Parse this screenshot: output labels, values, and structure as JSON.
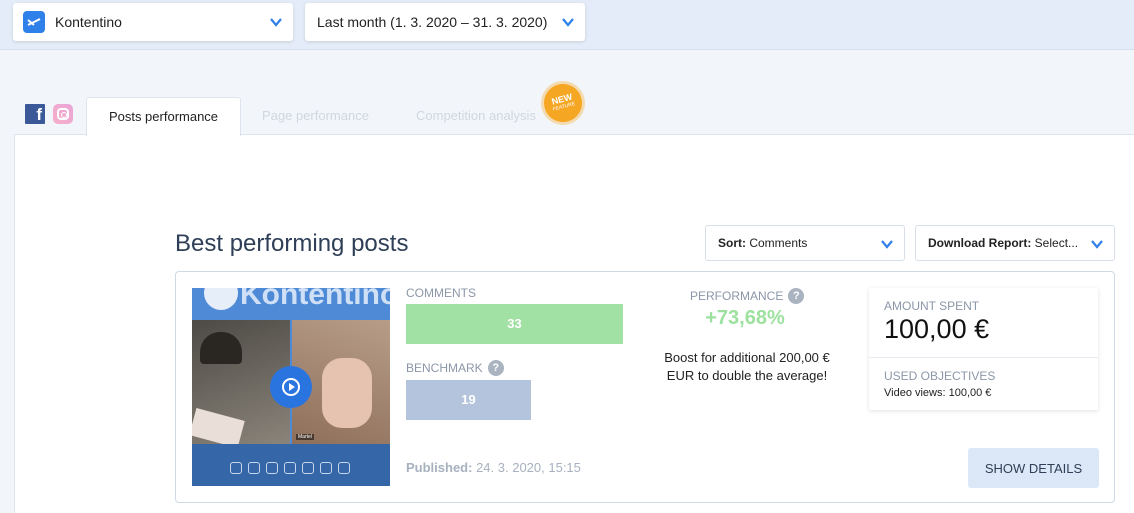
{
  "header": {
    "account_select": {
      "value": "Kontentino",
      "icon": "kontentino-logo-icon"
    },
    "date_select": {
      "value": "Last month (1. 3. 2020 – 31. 3. 2020)"
    }
  },
  "tabs": {
    "social": [
      "facebook-icon",
      "instagram-icon"
    ],
    "items": [
      {
        "label": "Posts performance",
        "active": true
      },
      {
        "label": "Page performance",
        "active": false
      },
      {
        "label": "Competition analysis",
        "active": false
      }
    ],
    "badge": {
      "text": "NEW",
      "subtext": "FEATURE"
    }
  },
  "section": {
    "title": "Best performing posts",
    "sort": {
      "label": "Sort:",
      "value": "Comments"
    },
    "report": {
      "label": "Download Report:",
      "value": "Select..."
    }
  },
  "post": {
    "thumbnail": {
      "brand": "Kontentino",
      "name_tag": "Martel",
      "controls": [
        "Cam",
        "Mic",
        "Share",
        "Record",
        "Chat",
        "People",
        "Leave"
      ]
    },
    "comments": {
      "label": "COMMENTS",
      "value": "33",
      "ratio": 1.0
    },
    "benchmark": {
      "label": "BENCHMARK",
      "value": "19",
      "ratio": 0.576
    },
    "published": {
      "label": "Published:",
      "value": "24. 3. 2020, 15:15"
    },
    "performance": {
      "label": "PERFORMANCE",
      "value": "+73,68%",
      "boost_text": "Boost for additional 200,00 € EUR to double the average!"
    },
    "spend": {
      "amount_label": "AMOUNT SPENT",
      "amount_value": "100,00 €",
      "objectives_label": "USED OBJECTIVES",
      "objectives_value": "Video views: 100,00 €"
    },
    "show_details": "SHOW DETAILS"
  },
  "colors": {
    "accent": "#2f80e8",
    "comments_bar": "#a1e1a3",
    "benchmark_bar": "#b4c4dc",
    "performance": "#9de19f",
    "badge": "#f5a623"
  }
}
